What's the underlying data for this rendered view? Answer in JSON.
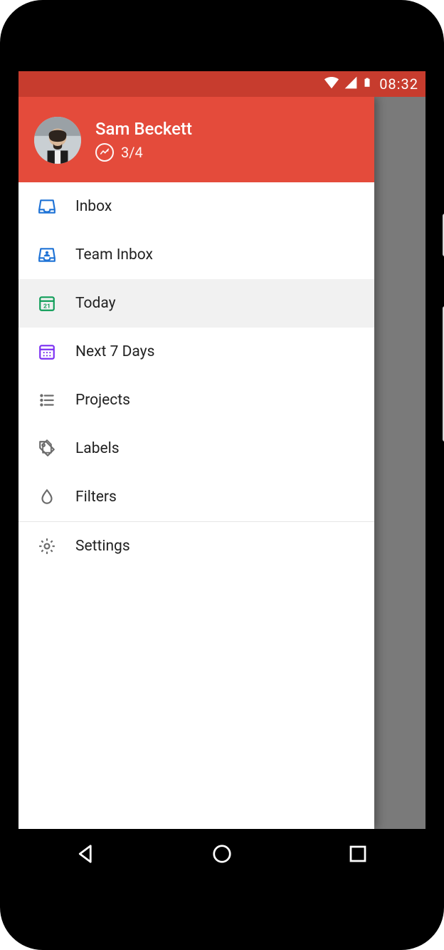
{
  "status": {
    "time": "08:32"
  },
  "header": {
    "user_name": "Sam Beckett",
    "karma_ratio": "3/4"
  },
  "menu": {
    "inbox": "Inbox",
    "team_inbox": "Team Inbox",
    "today": "Today",
    "next7": "Next 7 Days",
    "projects": "Projects",
    "labels": "Labels",
    "filters": "Filters",
    "settings": "Settings"
  },
  "colors": {
    "brand": "#e44b3b",
    "brand_dark": "#c73c2e",
    "icon_blue": "#1f73d6",
    "icon_green": "#0f9d58",
    "icon_purple": "#7b2ff2",
    "icon_grey": "#6b6b6b"
  }
}
